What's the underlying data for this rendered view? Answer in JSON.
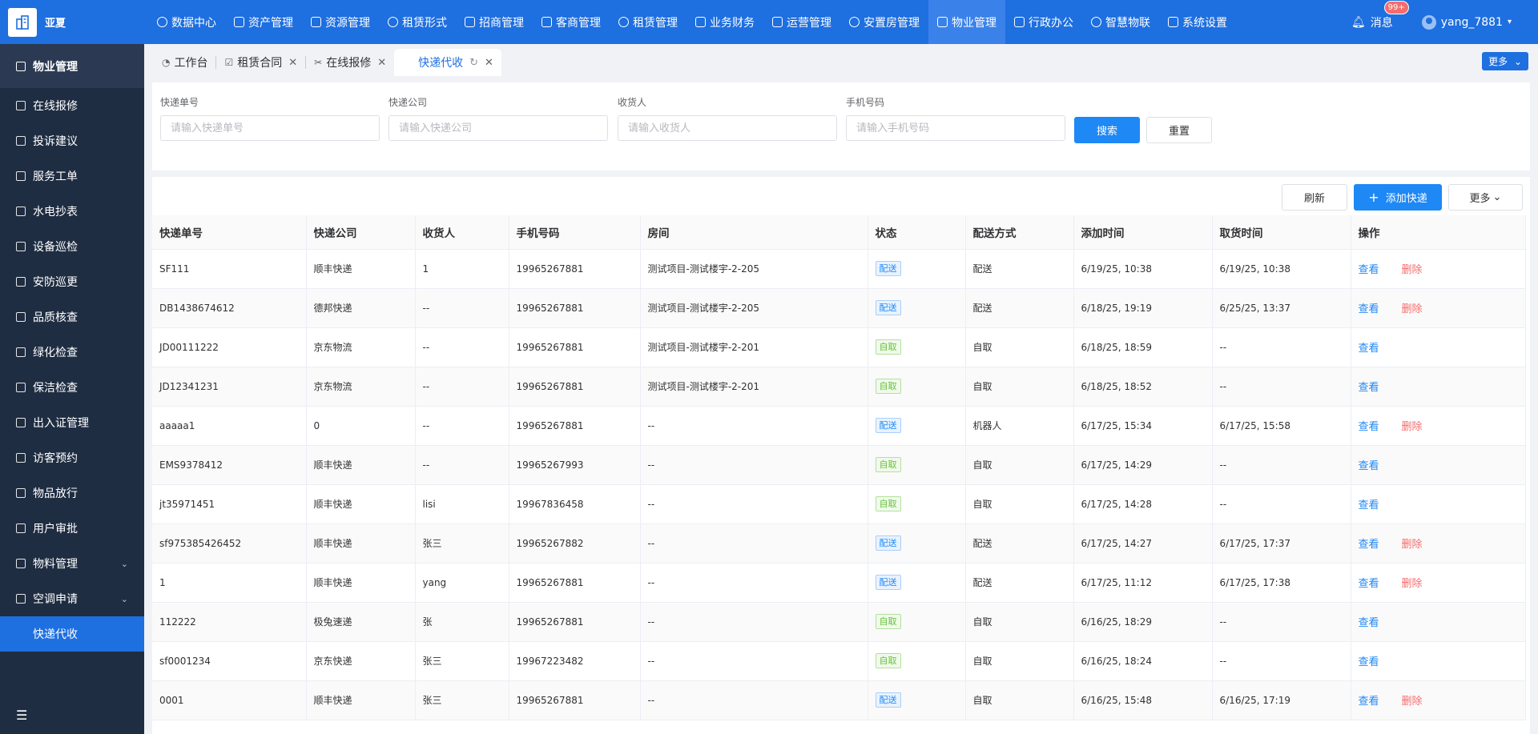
{
  "app": {
    "logo_text": "亚夏"
  },
  "nav": {
    "items": [
      {
        "label": "数据中心",
        "icon": "dashboard-icon"
      },
      {
        "label": "资产管理",
        "icon": "cube-icon"
      },
      {
        "label": "资源管理",
        "icon": "document-icon"
      },
      {
        "label": "租赁形式",
        "icon": "grid-icon"
      },
      {
        "label": "招商管理",
        "icon": "tag-icon"
      },
      {
        "label": "客商管理",
        "icon": "users-icon"
      },
      {
        "label": "租赁管理",
        "icon": "house-icon"
      },
      {
        "label": "业务财务",
        "icon": "coin-icon"
      },
      {
        "label": "运营管理",
        "icon": "chart-icon"
      },
      {
        "label": "安置房管理",
        "icon": "home-icon"
      },
      {
        "label": "物业管理",
        "icon": "home-outline-icon"
      },
      {
        "label": "行政办公",
        "icon": "monitor-icon"
      },
      {
        "label": "智慧物联",
        "icon": "sun-icon"
      },
      {
        "label": "系统设置",
        "icon": "gear-icon"
      }
    ],
    "active_label": "物业管理",
    "messages_label": "消息",
    "messages_badge": "99+",
    "username": "yang_7881"
  },
  "sidebar": {
    "title": "物业管理",
    "items": [
      {
        "label": "在线报修"
      },
      {
        "label": "投诉建议"
      },
      {
        "label": "服务工单"
      },
      {
        "label": "水电抄表"
      },
      {
        "label": "设备巡检"
      },
      {
        "label": "安防巡更"
      },
      {
        "label": "品质核查"
      },
      {
        "label": "绿化检查"
      },
      {
        "label": "保洁检查"
      },
      {
        "label": "出入证管理"
      },
      {
        "label": "访客预约"
      },
      {
        "label": "物品放行"
      },
      {
        "label": "用户审批"
      },
      {
        "label": "物料管理",
        "expandable": true
      },
      {
        "label": "空调申请",
        "expandable": true
      }
    ],
    "active_item": "快递代收"
  },
  "tabs": {
    "items": [
      "工作台",
      "租赁合同",
      "在线报修",
      "快递代收"
    ],
    "active": "快递代收",
    "more_label": "更多"
  },
  "search": {
    "fields": [
      {
        "label": "快递单号",
        "placeholder": "请输入快递单号",
        "value": ""
      },
      {
        "label": "快递公司",
        "placeholder": "请输入快递公司",
        "value": ""
      },
      {
        "label": "收货人",
        "placeholder": "请输入收货人",
        "value": ""
      },
      {
        "label": "手机号码",
        "placeholder": "请输入手机号码",
        "value": ""
      }
    ],
    "search_label": "搜索",
    "reset_label": "重置"
  },
  "toolbar": {
    "refresh_label": "刷新",
    "add_label": "添加快递",
    "more_label": "更多"
  },
  "table": {
    "columns": [
      "快递单号",
      "快递公司",
      "收货人",
      "手机号码",
      "房间",
      "状态",
      "配送方式",
      "添加时间",
      "取货时间",
      "操作"
    ],
    "view_label": "查看",
    "delete_label": "删除",
    "rows": [
      {
        "no": "SF111",
        "company": "顺丰快递",
        "receiver": "1",
        "phone": "19965267881",
        "room": "测试项目-测试楼宇-2-205",
        "status": "配送",
        "delivery": "配送",
        "added": "6/19/25, 10:38",
        "picked": "6/19/25, 10:38",
        "can_delete": true
      },
      {
        "no": "DB1438674612",
        "company": "德邦快递",
        "receiver": "--",
        "phone": "19965267881",
        "room": "测试项目-测试楼宇-2-205",
        "status": "配送",
        "delivery": "配送",
        "added": "6/18/25, 19:19",
        "picked": "6/25/25, 13:37",
        "can_delete": true
      },
      {
        "no": "JD00111222",
        "company": "京东物流",
        "receiver": "--",
        "phone": "19965267881",
        "room": "测试项目-测试楼宇-2-201",
        "status": "自取",
        "delivery": "自取",
        "added": "6/18/25, 18:59",
        "picked": "--",
        "can_delete": false
      },
      {
        "no": "JD12341231",
        "company": "京东物流",
        "receiver": "--",
        "phone": "19965267881",
        "room": "测试项目-测试楼宇-2-201",
        "status": "自取",
        "delivery": "自取",
        "added": "6/18/25, 18:52",
        "picked": "--",
        "can_delete": false
      },
      {
        "no": "aaaaa1",
        "company": "0",
        "receiver": "--",
        "phone": "19965267881",
        "room": "--",
        "status": "配送",
        "delivery": "机器人",
        "added": "6/17/25, 15:34",
        "picked": "6/17/25, 15:58",
        "can_delete": true
      },
      {
        "no": "EMS9378412",
        "company": "顺丰快递",
        "receiver": "--",
        "phone": "19965267993",
        "room": "--",
        "status": "自取",
        "delivery": "自取",
        "added": "6/17/25, 14:29",
        "picked": "--",
        "can_delete": false
      },
      {
        "no": "jt35971451",
        "company": "顺丰快递",
        "receiver": "lisi",
        "phone": "19967836458",
        "room": "--",
        "status": "自取",
        "delivery": "自取",
        "added": "6/17/25, 14:28",
        "picked": "--",
        "can_delete": false
      },
      {
        "no": "sf975385426452",
        "company": "顺丰快递",
        "receiver": "张三",
        "phone": "19965267882",
        "room": "--",
        "status": "配送",
        "delivery": "配送",
        "added": "6/17/25, 14:27",
        "picked": "6/17/25, 17:37",
        "can_delete": true
      },
      {
        "no": "1",
        "company": "顺丰快递",
        "receiver": "yang",
        "phone": "19965267881",
        "room": "--",
        "status": "配送",
        "delivery": "配送",
        "added": "6/17/25, 11:12",
        "picked": "6/17/25, 17:38",
        "can_delete": true
      },
      {
        "no": "112222",
        "company": "极兔速递",
        "receiver": "张",
        "phone": "19965267881",
        "room": "--",
        "status": "自取",
        "delivery": "自取",
        "added": "6/16/25, 18:29",
        "picked": "--",
        "can_delete": false
      },
      {
        "no": "sf0001234",
        "company": "京东快递",
        "receiver": "张三",
        "phone": "19967223482",
        "room": "--",
        "status": "自取",
        "delivery": "自取",
        "added": "6/16/25, 18:24",
        "picked": "--",
        "can_delete": false
      },
      {
        "no": "0001",
        "company": "顺丰快递",
        "receiver": "张三",
        "phone": "19965267881",
        "room": "--",
        "status": "配送",
        "delivery": "自取",
        "added": "6/16/25, 15:48",
        "picked": "6/16/25, 17:19",
        "can_delete": true
      }
    ]
  },
  "colors": {
    "primary": "#1e6fe0",
    "sidebar_bg": "#1f2d42",
    "tag_delivery": "#1e88f5",
    "tag_pickup": "#67c23a",
    "danger": "#f56c6c"
  }
}
